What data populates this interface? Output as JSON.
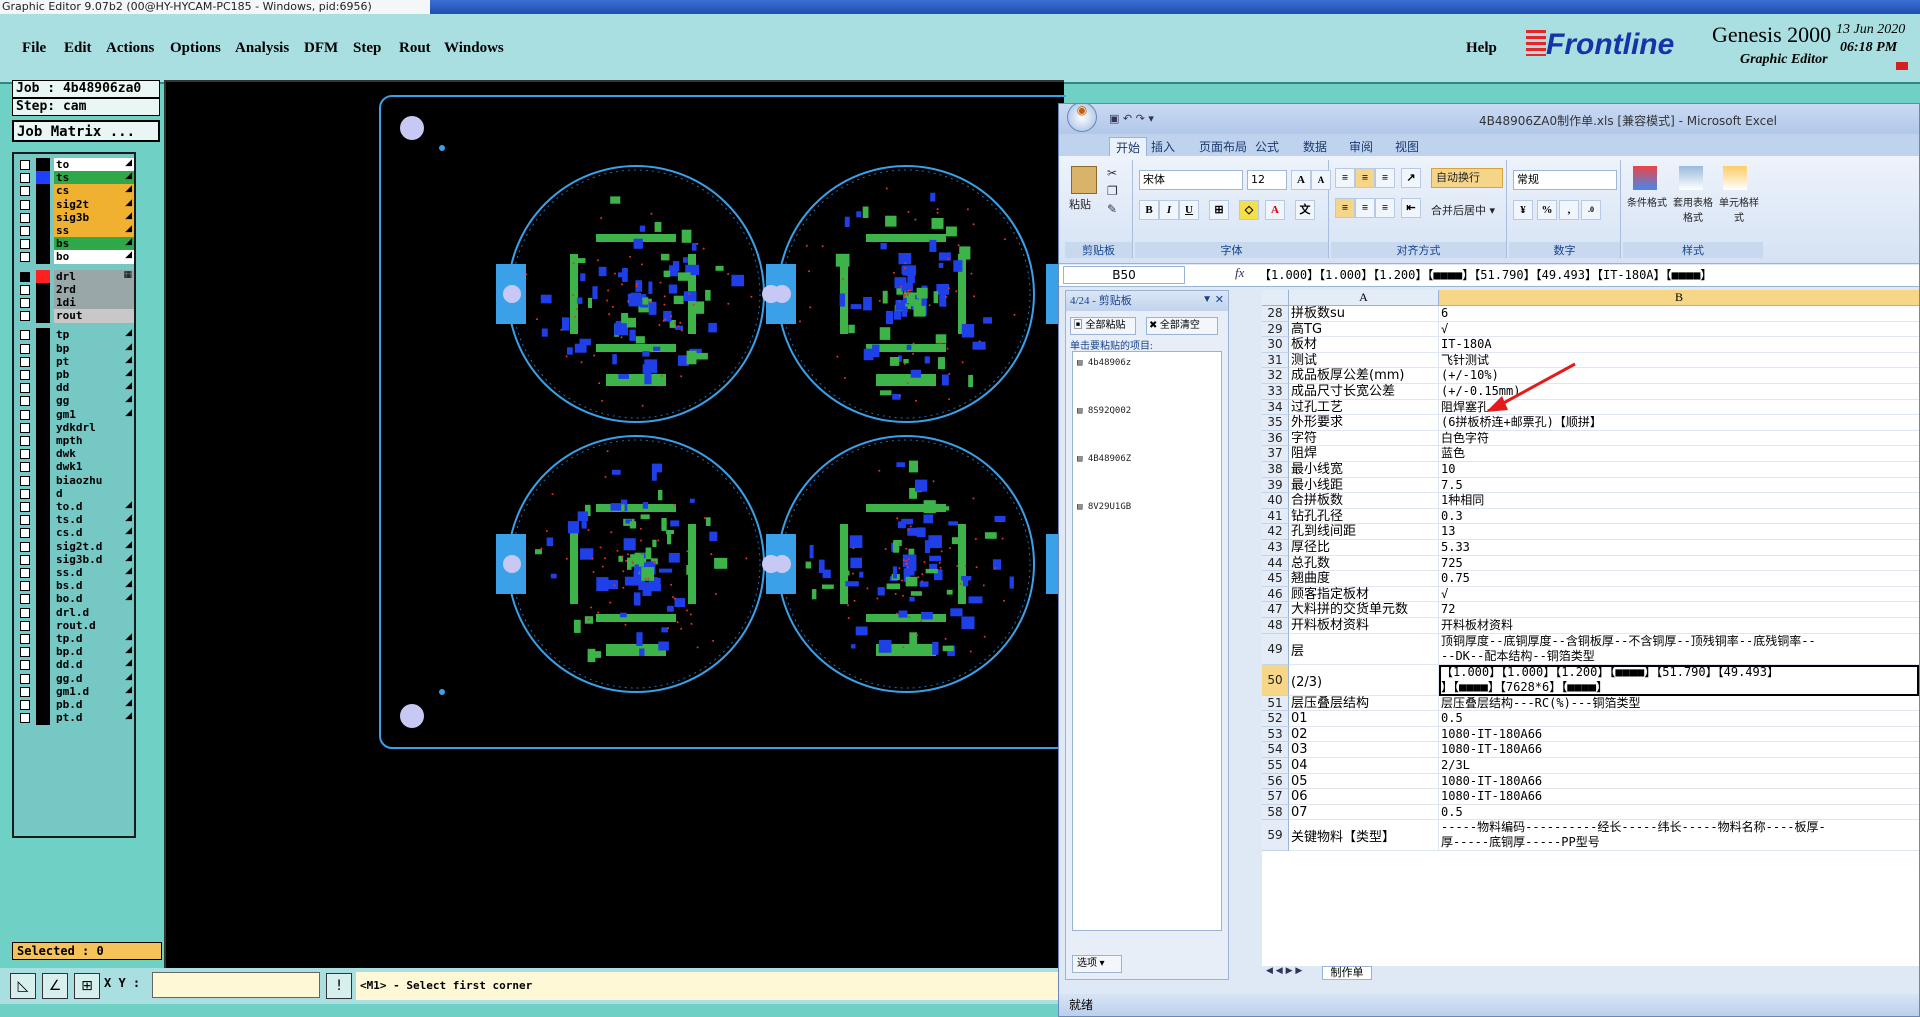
{
  "window_title": "Graphic Editor 9.07b2 (00@HY-HYCAM-PC185 - Windows, pid:6956)",
  "menu": {
    "file": "File",
    "edit": "Edit",
    "actions": "Actions",
    "options": "Options",
    "analysis": "Analysis",
    "dfm": "DFM",
    "step": "Step",
    "rout": "Rout",
    "windows": "Windows",
    "help": "Help"
  },
  "brand": {
    "logo": "Frontline",
    "product": "Genesis 2000",
    "subtitle": "Graphic Editor",
    "date": "13 Jun 2020",
    "time": "06:18 PM"
  },
  "job": {
    "job_label": "Job : 4b48906za0",
    "step_label": "Step: cam",
    "matrix_label": "Job Matrix ..."
  },
  "layers": [
    {
      "name": "to",
      "color": "#ffffff",
      "arrow": "◢"
    },
    {
      "name": "ts",
      "color": "#2fa84a",
      "arrow": "◢",
      "swatch": "#2040ff"
    },
    {
      "name": "cs",
      "color": "#f0b030",
      "arrow": "◢"
    },
    {
      "name": "sig2t",
      "color": "#f0b030",
      "arrow": "◢"
    },
    {
      "name": "sig3b",
      "color": "#f0b030",
      "arrow": "◢"
    },
    {
      "name": "ss",
      "color": "#f0b030",
      "arrow": "◢"
    },
    {
      "name": "bs",
      "color": "#2fa84a",
      "arrow": "◢"
    },
    {
      "name": "bo",
      "color": "#ffffff",
      "arrow": "◢"
    },
    {
      "name": "drl",
      "color": "#9aa7a8",
      "arrow": "▦",
      "swatch": "#ff2020",
      "sel": true
    },
    {
      "name": "2rd",
      "color": "#9aa7a8",
      "arrow": ""
    },
    {
      "name": "1di",
      "color": "#9aa7a8",
      "arrow": ""
    },
    {
      "name": "rout",
      "color": "#c8c8c8",
      "arrow": ""
    },
    {
      "name": "tp",
      "color": "#76c8c4",
      "arrow": "◢"
    },
    {
      "name": "bp",
      "color": "#76c8c4",
      "arrow": "◢"
    },
    {
      "name": "pt",
      "color": "#76c8c4",
      "arrow": "◢"
    },
    {
      "name": "pb",
      "color": "#76c8c4",
      "arrow": "◢"
    },
    {
      "name": "dd",
      "color": "#76c8c4",
      "arrow": "◢"
    },
    {
      "name": "gg",
      "color": "#76c8c4",
      "arrow": "◢"
    },
    {
      "name": "gm1",
      "color": "#76c8c4",
      "arrow": "◢"
    },
    {
      "name": "ydkdrl",
      "color": "#76c8c4",
      "arrow": ""
    },
    {
      "name": "mpth",
      "color": "#76c8c4",
      "arrow": ""
    },
    {
      "name": "dwk",
      "color": "#76c8c4",
      "arrow": ""
    },
    {
      "name": "dwk1",
      "color": "#76c8c4",
      "arrow": ""
    },
    {
      "name": "biaozhu",
      "color": "#76c8c4",
      "arrow": ""
    },
    {
      "name": "d",
      "color": "#76c8c4",
      "arrow": ""
    },
    {
      "name": "to.d",
      "color": "#76c8c4",
      "arrow": "◢"
    },
    {
      "name": "ts.d",
      "color": "#76c8c4",
      "arrow": "◢"
    },
    {
      "name": "cs.d",
      "color": "#76c8c4",
      "arrow": "◢"
    },
    {
      "name": "sig2t.d",
      "color": "#76c8c4",
      "arrow": "◢"
    },
    {
      "name": "sig3b.d",
      "color": "#76c8c4",
      "arrow": "◢"
    },
    {
      "name": "ss.d",
      "color": "#76c8c4",
      "arrow": "◢"
    },
    {
      "name": "bs.d",
      "color": "#76c8c4",
      "arrow": "◢"
    },
    {
      "name": "bo.d",
      "color": "#76c8c4",
      "arrow": "◢"
    },
    {
      "name": "drl.d",
      "color": "#76c8c4",
      "arrow": ""
    },
    {
      "name": "rout.d",
      "color": "#76c8c4",
      "arrow": ""
    },
    {
      "name": "tp.d",
      "color": "#76c8c4",
      "arrow": "◢"
    },
    {
      "name": "bp.d",
      "color": "#76c8c4",
      "arrow": "◢"
    },
    {
      "name": "dd.d",
      "color": "#76c8c4",
      "arrow": "◢"
    },
    {
      "name": "gg.d",
      "color": "#76c8c4",
      "arrow": "◢"
    },
    {
      "name": "gm1.d",
      "color": "#76c8c4",
      "arrow": "◢"
    },
    {
      "name": "pb.d",
      "color": "#76c8c4",
      "arrow": "◢"
    },
    {
      "name": "pt.d",
      "color": "#76c8c4",
      "arrow": "◢"
    }
  ],
  "selected_label": "Selected : 0",
  "bottom": {
    "xy_label": "X Y :",
    "xy_value": "",
    "status": "<M1> - Select first corner"
  },
  "excel": {
    "title": "4B48906ZA0制作单.xls  [兼容模式]  -  Microsoft Excel",
    "tabs": [
      "开始",
      "插入",
      "页面布局",
      "公式",
      "数据",
      "审阅",
      "视图"
    ],
    "groups": {
      "clipboard": "剪贴板",
      "font": "字体",
      "align": "对齐方式",
      "number": "数字",
      "styles": "样式"
    },
    "paste_label": "粘贴",
    "font_name": "宋体",
    "font_size": "12",
    "wrap_label": "自动换行",
    "merge_label": "合并后居中 ▾",
    "number_format": "常规",
    "style_btns": [
      "条件格式",
      "套用表格格式",
      "单元格样式"
    ],
    "name_box": "B50",
    "formula": "【1.000】【1.000】【1.200】【■■■■】【51.790】【49.493】【IT-180A】【■■■■】",
    "clipboard_panel": {
      "header": "4/24 - 剪贴板",
      "paste_all": "全部粘贴",
      "clear_all": "全部清空",
      "hint": "单击要粘贴的项目:",
      "items": [
        "4b48906z",
        "8S92Q002",
        "4B48906Z",
        "8V29U1GB"
      ],
      "options": "选项 ▾"
    },
    "col_a": "A",
    "col_b": "B",
    "rows": [
      {
        "n": "28",
        "a": "拼板数su",
        "b": "6"
      },
      {
        "n": "29",
        "a": "高TG",
        "b": "√"
      },
      {
        "n": "30",
        "a": "板材",
        "b": "IT-180A"
      },
      {
        "n": "31",
        "a": "测试",
        "b": "飞针测试"
      },
      {
        "n": "32",
        "a": "成品板厚公差(mm)",
        "b": "(+/-10%)"
      },
      {
        "n": "33",
        "a": "成品尺寸长宽公差",
        "b": "(+/-0.15mm)"
      },
      {
        "n": "34",
        "a": "过孔工艺",
        "b": "阻焊塞孔"
      },
      {
        "n": "35",
        "a": "外形要求",
        "b": "(6拼板桥连+邮票孔)【顺拼】"
      },
      {
        "n": "36",
        "a": "字符",
        "b": "白色字符"
      },
      {
        "n": "37",
        "a": "阻焊",
        "b": "蓝色"
      },
      {
        "n": "38",
        "a": "最小线宽",
        "b": "10"
      },
      {
        "n": "39",
        "a": "最小线距",
        "b": "7.5"
      },
      {
        "n": "40",
        "a": "合拼板数",
        "b": "1种相同"
      },
      {
        "n": "41",
        "a": "钻孔孔径",
        "b": "0.3"
      },
      {
        "n": "42",
        "a": "孔到线间距",
        "b": "13"
      },
      {
        "n": "43",
        "a": "厚径比",
        "b": "5.33"
      },
      {
        "n": "44",
        "a": "总孔数",
        "b": "725"
      },
      {
        "n": "45",
        "a": "翘曲度",
        "b": "0.75"
      },
      {
        "n": "46",
        "a": "顾客指定板材",
        "b": "√"
      },
      {
        "n": "47",
        "a": "大料拼的交货单元数",
        "b": "72"
      },
      {
        "n": "48",
        "a": "开料板材资料",
        "b": "开料板材资料"
      },
      {
        "n": "49",
        "a": "层",
        "b": "顶铜厚度--底铜厚度--含铜板厚--不含铜厚--顶残铜率--底残铜率--",
        "b2": "--DK--配本结构--铜箔类型",
        "tall": true
      },
      {
        "n": "50",
        "a": "(2/3)",
        "b": "【1.000】【1.000】【1.200】【■■■■】【51.790】【49.493】",
        "b2": "】【■■■■】【7628*6】【■■■■】",
        "tall": true,
        "active": true
      },
      {
        "n": "51",
        "a": "层压叠层结构",
        "b": "层压叠层结构---RC(%)---铜箔类型"
      },
      {
        "n": "52",
        "a": "01",
        "b": "0.5"
      },
      {
        "n": "53",
        "a": "02",
        "b": "1080-IT-180A66"
      },
      {
        "n": "54",
        "a": "03",
        "b": "1080-IT-180A66"
      },
      {
        "n": "55",
        "a": "04",
        "b": "2/3L"
      },
      {
        "n": "56",
        "a": "05",
        "b": "1080-IT-180A66"
      },
      {
        "n": "57",
        "a": "06",
        "b": "1080-IT-180A66"
      },
      {
        "n": "58",
        "a": "07",
        "b": "0.5"
      },
      {
        "n": "59",
        "a": "关键物料【类型】",
        "b": "-----物料编码----------经长-----纬长-----物料名称----板厚-",
        "b2": "厚-----底铜厚-----PP型号",
        "tall": true
      }
    ],
    "sheet_tab": "制作单",
    "status": "就绪"
  }
}
